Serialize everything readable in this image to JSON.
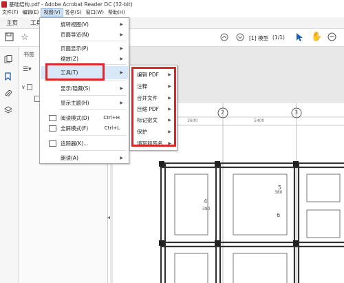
{
  "window": {
    "title": "基础结构.pdf - Adobe Acrobat Reader DC (32-bit)"
  },
  "menubar": {
    "items": [
      "文件(F)",
      "编辑(E)",
      "视图(V)",
      "签名(S)",
      "窗口(W)",
      "帮助(H)"
    ],
    "active_index": 2
  },
  "tabs": [
    "主页",
    "工具"
  ],
  "toolbar": {
    "page_display": "[1] 模型",
    "page_count": "(1/1)"
  },
  "navpane": {
    "title": "书签"
  },
  "view_menu": {
    "items": [
      {
        "label": "旋转视图(V)",
        "submenu": true
      },
      {
        "label": "页面导览(N)",
        "submenu": true
      },
      {
        "label": "页面显示(P)",
        "submenu": true
      },
      {
        "label": "缩放(Z)",
        "submenu": true
      },
      {
        "label": "工具(T)",
        "submenu": true
      },
      {
        "label": "显示/隐藏(S)",
        "submenu": true
      },
      {
        "label": "显示主题(H)",
        "submenu": true
      },
      {
        "label": "阅读模式(D)",
        "shortcut": "Ctrl+H"
      },
      {
        "label": "全屏模式(F)",
        "shortcut": "Ctrl+L"
      },
      {
        "label": "追踪器(K)..."
      },
      {
        "label": "朗读(A)",
        "submenu": true
      }
    ]
  },
  "tools_submenu": {
    "items": [
      "编辑 PDF",
      "注释",
      "合并文件",
      "压缩 PDF",
      "标记密文",
      "保护",
      "填写和签名"
    ]
  },
  "drawing": {
    "axis_labels": [
      "2",
      "3"
    ],
    "dimensions": [
      "3600",
      "5400"
    ],
    "room_numbers": [
      "4",
      "5",
      "6"
    ],
    "beam_labels": [
      "380",
      "380"
    ]
  },
  "colors": {
    "highlight": "#d7262c",
    "menu_selected": "#d8e8f8",
    "active_menu": "#cfe3f6"
  }
}
